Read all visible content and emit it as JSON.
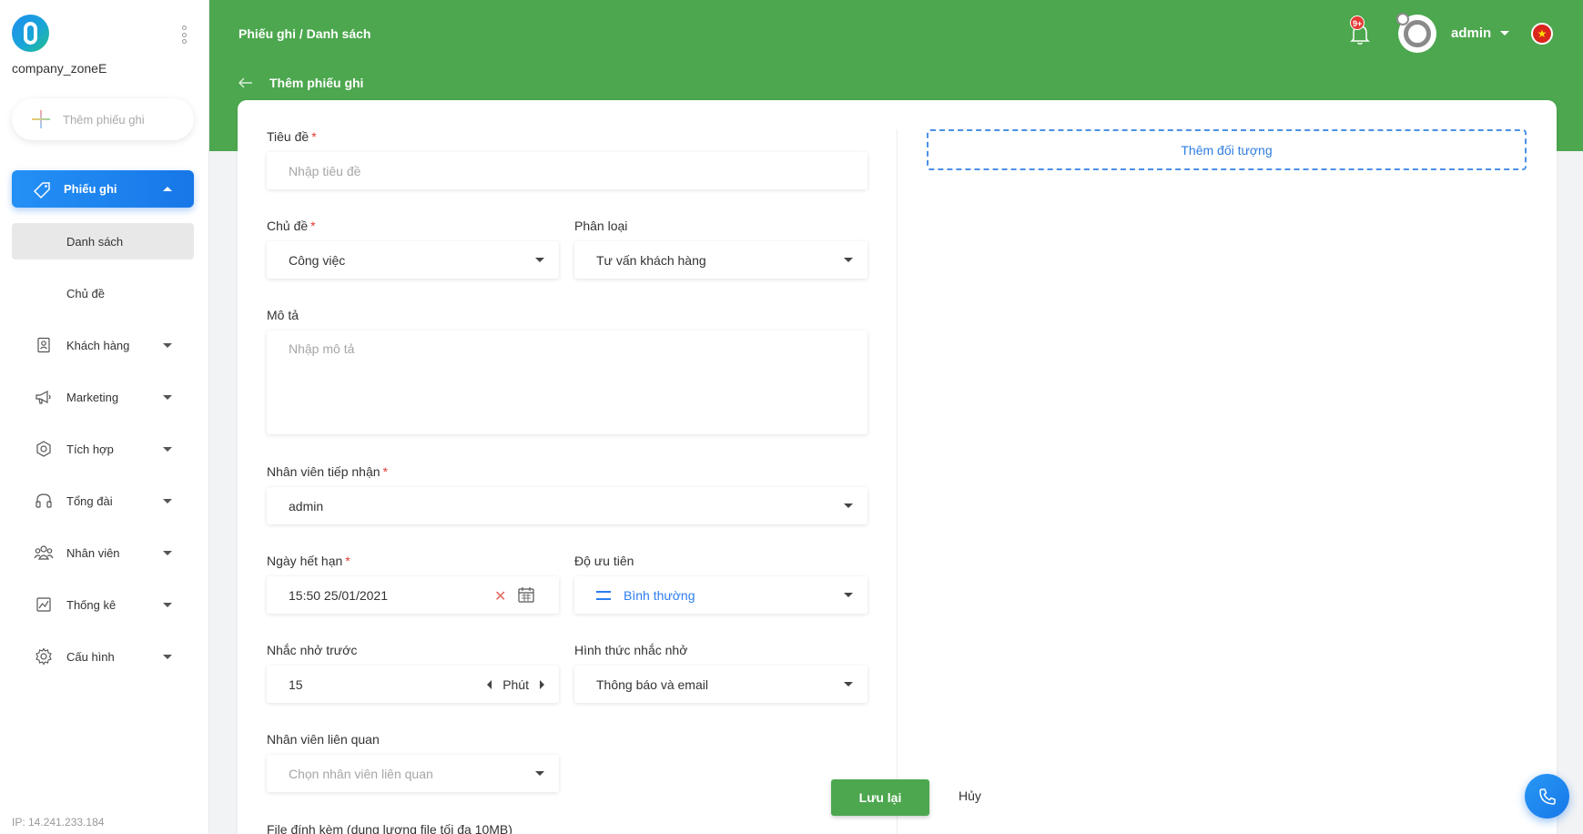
{
  "sidebar": {
    "company": "company_zoneE",
    "add_ticket_label": "Thêm phiếu ghi",
    "active_menu": "Phiếu ghi",
    "sub_items": [
      "Danh sách",
      "Chủ đề"
    ],
    "items": [
      {
        "label": "Khách hàng",
        "icon": "contact-book-icon"
      },
      {
        "label": "Marketing",
        "icon": "megaphone-icon"
      },
      {
        "label": "Tích hợp",
        "icon": "integration-icon"
      },
      {
        "label": "Tổng đài",
        "icon": "headset-icon"
      },
      {
        "label": "Nhân viên",
        "icon": "group-icon"
      },
      {
        "label": "Thống kê",
        "icon": "chart-icon"
      },
      {
        "label": "Cấu hình",
        "icon": "gear-icon"
      }
    ],
    "ip": "IP: 14.241.233.184"
  },
  "header": {
    "breadcrumb": "Phiếu ghi / Danh sách",
    "page_title": "Thêm phiếu ghi",
    "notification_count": "9+",
    "username": "admin",
    "accent": "#4ca74e"
  },
  "form": {
    "title_label": "Tiêu đề",
    "title_placeholder": "Nhập tiêu đề",
    "topic_label": "Chủ đề",
    "topic_value": "Công việc",
    "category_label": "Phân loại",
    "category_value": "Tư vấn khách hàng",
    "desc_label": "Mô tả",
    "desc_placeholder": "Nhập mô tả",
    "assignee_label": "Nhân viên tiếp nhận",
    "assignee_value": "admin",
    "due_label": "Ngày hết hạn",
    "due_value": "15:50 25/01/2021",
    "priority_label": "Độ ưu tiên",
    "priority_value": "Bình thường",
    "remind_label": "Nhắc nhở trước",
    "remind_value": "15",
    "remind_unit": "Phút",
    "remind_method_label": "Hình thức nhắc nhở",
    "remind_method_value": "Thông báo và email",
    "related_label": "Nhân viên liên quan",
    "related_placeholder": "Chọn nhân viên liên quan",
    "attachment_label": "File đính kèm (dung lượng file tối đa 10MB)",
    "required_mark": "*"
  },
  "right_panel": {
    "add_object_label": "Thêm đối tượng"
  },
  "actions": {
    "save_label": "Lưu lại",
    "cancel_label": "Hủy"
  }
}
